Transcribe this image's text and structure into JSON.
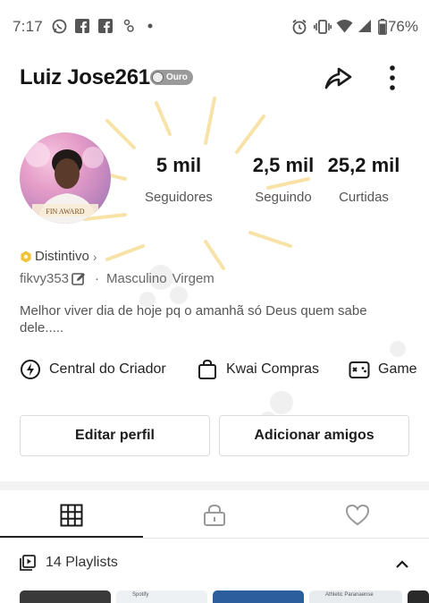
{
  "status_bar": {
    "time": "7:17",
    "battery": "76%",
    "notification_icons": [
      "whatsapp-icon",
      "facebook-icon",
      "facebook-icon",
      "app-icon",
      "dot-icon"
    ],
    "system_icons": [
      "alarm-icon",
      "vibrate-icon",
      "wifi-icon",
      "signal-icon",
      "battery-icon"
    ]
  },
  "profile": {
    "username": "Luiz Jose261",
    "badge": "Ouro",
    "stats": [
      {
        "value": "5 mil",
        "label": "Seguidores"
      },
      {
        "value": "2,5 mil",
        "label": "Seguindo"
      },
      {
        "value": "25,2 mil",
        "label": "Curtidas"
      }
    ],
    "distintivo": "Distintivo",
    "handle": "fikvy353",
    "gender": "Masculino",
    "zodiac": "Virgem",
    "bio": "Melhor viver dia de hoje pq o amanhã só Deus quem sabe dele....."
  },
  "quick_actions": [
    {
      "label": "Central do Criador",
      "icon": "lightning-icon"
    },
    {
      "label": "Kwai Compras",
      "icon": "shopping-bag-icon"
    },
    {
      "label": "Game",
      "icon": "gamepad-icon"
    }
  ],
  "buttons": {
    "edit": "Editar perfil",
    "add_friends": "Adicionar amigos"
  },
  "tabs": [
    {
      "name": "grid",
      "icon": "grid-icon",
      "active": true
    },
    {
      "name": "private",
      "icon": "lock-icon",
      "active": false
    },
    {
      "name": "likes",
      "icon": "heart-icon",
      "active": false
    }
  ],
  "playlists": {
    "label": "14 Playlists",
    "thumbnails": [
      "Spotify",
      "",
      "Athletic Paranaense"
    ]
  },
  "colors": {
    "accent_gold": "#f0c23a",
    "badge_gray": "#9a9a9a",
    "text_dark": "#151515"
  }
}
